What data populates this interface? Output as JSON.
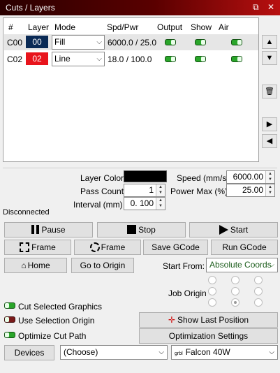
{
  "window": {
    "title": "Cuts / Layers",
    "restore_glyph": "⧉",
    "close_glyph": "✕"
  },
  "grid": {
    "headers": [
      "#",
      "Layer",
      "Mode",
      "Spd/Pwr",
      "Output",
      "Show",
      "Air"
    ],
    "rows": [
      {
        "id": "C00",
        "layer": "00",
        "layer_color": "#0a2a55",
        "mode": "Fill",
        "spd_pwr": "6000.0 / 25.0",
        "output": true,
        "show": true,
        "air": true
      },
      {
        "id": "C02",
        "layer": "02",
        "layer_color": "#e8141c",
        "mode": "Line",
        "spd_pwr": "18.0 / 100.0",
        "output": true,
        "show": true,
        "air": true
      }
    ]
  },
  "side_buttons": {
    "up": "▲",
    "down": "▼",
    "delete": "🗑",
    "right": "▶",
    "left": "◀"
  },
  "settings": {
    "layer_color_label": "Layer Color",
    "layer_color_value": "#000000",
    "pass_count_label": "Pass Count",
    "pass_count_value": "1",
    "interval_label": "Interval (mm)",
    "interval_value": "0. 100",
    "speed_label": "Speed (mm/s)",
    "speed_value": "6000.00",
    "power_max_label": "Power Max (%)",
    "power_max_value": "25.00"
  },
  "status": {
    "connection": "Disconnected"
  },
  "controls": {
    "pause": "Pause",
    "stop": "Stop",
    "start": "Start",
    "frame_rect": "Frame",
    "frame_circle": "Frame",
    "save_gcode": "Save GCode",
    "run_gcode": "Run GCode",
    "home": "Home",
    "go_to_origin": "Go to Origin",
    "start_from_label": "Start From:",
    "start_from_value": "Absolute Coords",
    "job_origin_label": "Job Origin"
  },
  "options": {
    "cut_selected": {
      "label": "Cut Selected Graphics",
      "on": true
    },
    "use_selection_origin": {
      "label": "Use Selection Origin",
      "on": false
    },
    "optimize_cut_path": {
      "label": "Optimize Cut Path",
      "on": true
    },
    "show_last_position": "Show Last Position",
    "optimization_settings": "Optimization Settings"
  },
  "devices": {
    "button": "Devices",
    "choose_value": "(Choose)",
    "device_prefix": "grbl",
    "device_value": "Falcon 40W"
  },
  "colors": {
    "accent_green": "#2aa52a",
    "accent_red": "#e8141c",
    "title_dark": "#2a0000"
  }
}
